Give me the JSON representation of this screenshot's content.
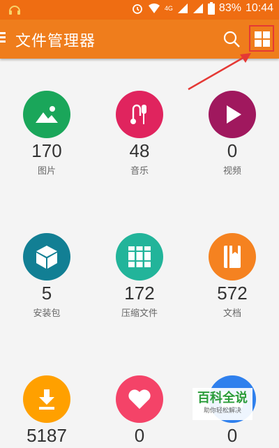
{
  "status_bar": {
    "network": "4G",
    "battery": "83%",
    "time": "10:44"
  },
  "app_bar": {
    "title": "文件管理器"
  },
  "categories": [
    {
      "label": "图片",
      "count": "170",
      "color": "#1aa65a",
      "icon": "image-icon"
    },
    {
      "label": "音乐",
      "count": "48",
      "color": "#e0245e",
      "icon": "music-icon"
    },
    {
      "label": "视频",
      "count": "0",
      "color": "#a0185e",
      "icon": "play-icon"
    },
    {
      "label": "安装包",
      "count": "5",
      "color": "#127f94",
      "icon": "package-icon"
    },
    {
      "label": "压缩文件",
      "count": "172",
      "color": "#22b49a",
      "icon": "archive-icon"
    },
    {
      "label": "文档",
      "count": "572",
      "color": "#f58220",
      "icon": "document-icon"
    },
    {
      "label": "",
      "count": "5187",
      "color": "#ffa000",
      "icon": "download-icon"
    },
    {
      "label": "",
      "count": "0",
      "color": "#f44368",
      "icon": "heart-icon"
    },
    {
      "label": "",
      "count": "0",
      "color": "#2f80ed",
      "icon": "folder-icon"
    }
  ],
  "watermark": {
    "title": "百科全说",
    "subtitle": "助你轻松解决"
  },
  "colors": {
    "app_bar": "#ef7d1c",
    "highlight_box": "#e53935"
  }
}
